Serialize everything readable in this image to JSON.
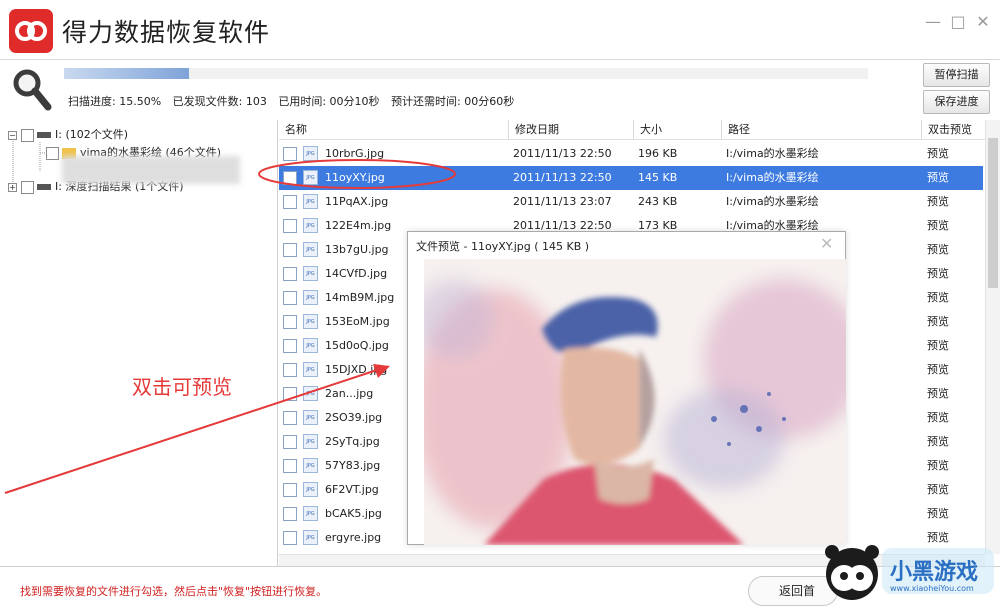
{
  "app": {
    "title": "得力数据恢复软件"
  },
  "window_controls": {
    "minimize": "—",
    "maximize": "□",
    "close": "✕"
  },
  "scan": {
    "progress_percent": 15.5,
    "progress_text": "扫描进度: 15.50%",
    "found_text": "已发现文件数: 103",
    "elapsed_text": "已用时间: 00分10秒",
    "remaining_text": "预计还需时间: 00分60秒",
    "pause_label": "暂停扫描",
    "save_label": "保存进度"
  },
  "tree": {
    "drive_label": "I:  (102个文件)",
    "folder_label": "vima的水墨彩绘  (46个文件)",
    "deep_label": "I: 深度扫描结果 (1个文件)"
  },
  "columns": {
    "name": "名称",
    "date": "修改日期",
    "size": "大小",
    "path": "路径",
    "preview": "双击预览"
  },
  "files": [
    {
      "name": "10rbrG.jpg",
      "date": "2011/11/13 22:50",
      "size": "196 KB",
      "path": "I:/vima的水墨彩绘",
      "preview": "预览",
      "selected": false
    },
    {
      "name": "11oyXY.jpg",
      "date": "2011/11/13 22:50",
      "size": "145 KB",
      "path": "I:/vima的水墨彩绘",
      "preview": "预览",
      "selected": true
    },
    {
      "name": "11PqAX.jpg",
      "date": "2011/11/13 23:07",
      "size": "243 KB",
      "path": "I:/vima的水墨彩绘",
      "preview": "预览",
      "selected": false
    },
    {
      "name": "122E4m.jpg",
      "date": "2011/11/13 22:50",
      "size": "173 KB",
      "path": "I:/vima的水墨彩绘",
      "preview": "预览",
      "selected": false
    },
    {
      "name": "13b7gU.jpg",
      "date": "",
      "size": "",
      "path": "",
      "preview": "预览",
      "selected": false
    },
    {
      "name": "14CVfD.jpg",
      "date": "",
      "size": "",
      "path": "",
      "preview": "预览",
      "selected": false
    },
    {
      "name": "14mB9M.jpg",
      "date": "",
      "size": "",
      "path": "",
      "preview": "预览",
      "selected": false
    },
    {
      "name": "153EoM.jpg",
      "date": "",
      "size": "",
      "path": "",
      "preview": "预览",
      "selected": false
    },
    {
      "name": "15d0oQ.jpg",
      "date": "",
      "size": "",
      "path": "",
      "preview": "预览",
      "selected": false
    },
    {
      "name": "15DJXD.jpg",
      "date": "",
      "size": "",
      "path": "",
      "preview": "预览",
      "selected": false
    },
    {
      "name": "2an...jpg",
      "date": "",
      "size": "",
      "path": "",
      "preview": "预览",
      "selected": false
    },
    {
      "name": "2SO39.jpg",
      "date": "",
      "size": "",
      "path": "",
      "preview": "预览",
      "selected": false
    },
    {
      "name": "2SyTq.jpg",
      "date": "",
      "size": "",
      "path": "",
      "preview": "预览",
      "selected": false
    },
    {
      "name": "57Y83.jpg",
      "date": "",
      "size": "",
      "path": "",
      "preview": "预览",
      "selected": false
    },
    {
      "name": "6F2VT.jpg",
      "date": "",
      "size": "",
      "path": "",
      "preview": "预览",
      "selected": false
    },
    {
      "name": "bCAK5.jpg",
      "date": "",
      "size": "",
      "path": "",
      "preview": "预览",
      "selected": false
    },
    {
      "name": "ergyre.jpg",
      "date": "",
      "size": "",
      "path": "",
      "preview": "预览",
      "selected": false
    }
  ],
  "file_icon_label": "JPG",
  "preview_popup": {
    "title": "文件预览 - 11oyXY.jpg ( 145 KB )",
    "close": "✕"
  },
  "annotation": {
    "text": "双击可预览",
    "color": "#e53a3a"
  },
  "footer": {
    "note": "找到需要恢复的文件进行勾选，然后点击\"恢复\"按钮进行恢复。",
    "back_label": "返回首"
  },
  "watermark": {
    "name": "小黑游戏",
    "url": "www.xiaoheiYou.com"
  },
  "colors": {
    "brand_red": "#e02b2b",
    "selection_blue": "#3d7be0",
    "annotation_red": "#e53a3a",
    "progress_blue": "#7fa3d9"
  }
}
